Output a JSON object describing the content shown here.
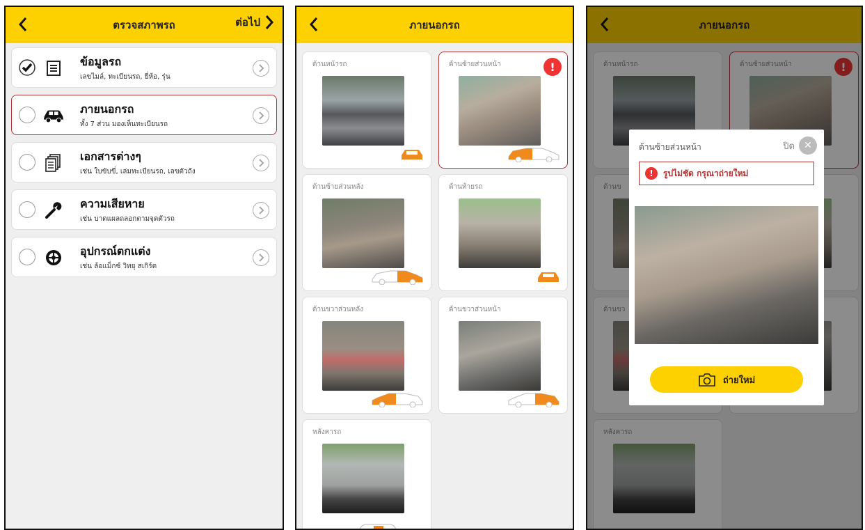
{
  "screen1": {
    "title": "ตรวจสภาพรถ",
    "next_label": "ต่อไป",
    "items": [
      {
        "title": "ข้อมูลรถ",
        "sub": "เลขไมล์, ทะเบียนรถ, ยี่ห้อ, รุ่น",
        "checked": true,
        "icon": "list-icon"
      },
      {
        "title": "ภายนอกรถ",
        "sub": "ทั้ง 7 ส่วน มองเห็นทะเบียนรถ",
        "checked": false,
        "icon": "car-icon"
      },
      {
        "title": "เอกสารต่างๆ",
        "sub": "เช่น ใบขับขี่, เล่มทะเบียนรถ, เลขตัวถัง",
        "checked": false,
        "icon": "documents-icon"
      },
      {
        "title": "ความเสียหาย",
        "sub": "เช่น บาดแผลถลอกตามจุดตัวรถ",
        "checked": false,
        "icon": "wrench-icon"
      },
      {
        "title": "อุปกรณ์ตกแต่ง",
        "sub": "เช่น ล้อแม็กซ์ วิทยุ สเกิร์ต",
        "checked": false,
        "icon": "wheel-icon"
      }
    ]
  },
  "screen2": {
    "title": "ภายนอกรถ",
    "cards": [
      {
        "label": "ด้านหน้ารถ",
        "error": false
      },
      {
        "label": "ด้านซ้ายส่วนหน้า",
        "error": true
      },
      {
        "label": "ด้านซ้ายส่วนหลัง",
        "error": false
      },
      {
        "label": "ด้านท้ายรถ",
        "error": false
      },
      {
        "label": "ด้านขวาส่วนหลัง",
        "error": false
      },
      {
        "label": "ด้านขวาส่วนหน้า",
        "error": false
      },
      {
        "label": "หลังคารถ",
        "error": false
      }
    ]
  },
  "screen3": {
    "title": "ภายนอกรถ",
    "modal": {
      "label": "ด้านซ้ายส่วนหน้า",
      "close_label": "ปิด",
      "error_text": "รูปไม่ชัด กรุณาถ่ายใหม่",
      "retake_label": "ถ่ายใหม่"
    },
    "bg_labels": [
      "ด้านหน้ารถ",
      "ด้านซ้ายส่วนหน้า",
      "ด้านข",
      "ด้านขว",
      "หลังคารถ"
    ]
  },
  "colors": {
    "accent": "#fdd000",
    "error": "#e33333",
    "orange": "#f08a1c"
  }
}
